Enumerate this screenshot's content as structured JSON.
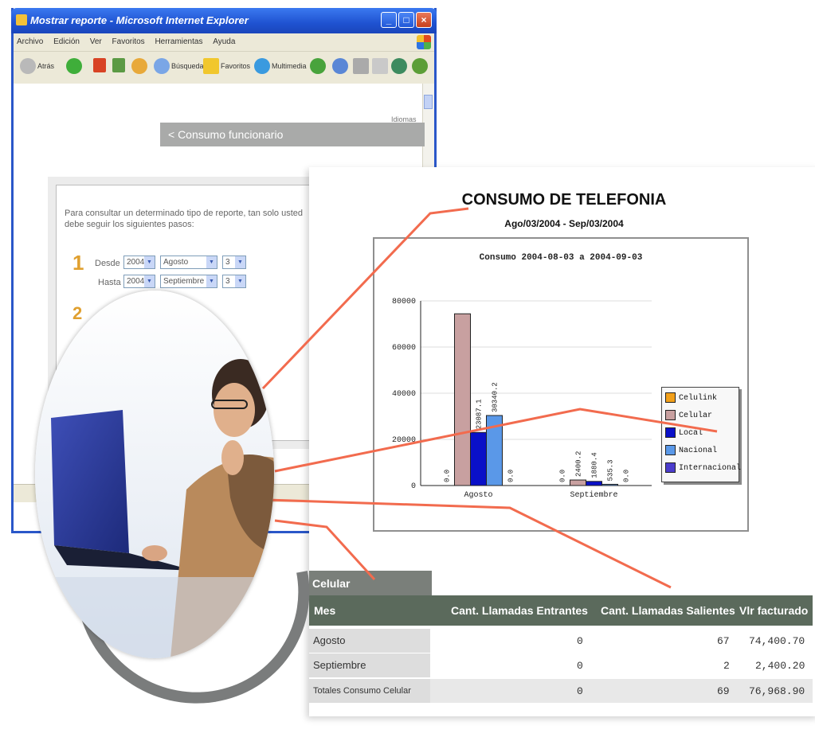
{
  "browser": {
    "title": "Mostrar reporte - Microsoft Internet Explorer",
    "menu": [
      "Archivo",
      "Edición",
      "Ver",
      "Favoritos",
      "Herramientas",
      "Ayuda"
    ],
    "toolbar": {
      "back": "Atrás",
      "search": "Búsqueda",
      "favorites": "Favoritos",
      "multimedia": "Multimedia"
    },
    "idioma": "Idiomas",
    "section_bar": "< Consumo funcionario"
  },
  "form": {
    "instructions": "Para consultar un determinado tipo de reporte, tan solo usted debe seguir los siguientes pasos:",
    "step1": "1",
    "step2": "2",
    "desde_label": "Desde",
    "hasta_label": "Hasta",
    "desde": {
      "year": "2004",
      "month": "Agosto",
      "day": "3"
    },
    "hasta": {
      "year": "2004",
      "month": "Septiembre",
      "day": "3"
    }
  },
  "report": {
    "title": "CONSUMO DE TELEFONIA",
    "subtitle": "Ago/03/2004 - Sep/03/2004"
  },
  "chart_data": {
    "type": "bar",
    "title": "Consumo  2004-08-03 a 2004-09-03",
    "categories": [
      "Agosto",
      "Septiembre"
    ],
    "ylim": [
      0,
      80000
    ],
    "yticks": [
      "0",
      "20000",
      "40000",
      "60000",
      "80000"
    ],
    "series": [
      {
        "name": "Celulink",
        "color": "#f2a01a",
        "values": [
          0,
          0
        ],
        "labels": [
          "0.0",
          "0.0"
        ]
      },
      {
        "name": "Celular",
        "color": "#c8a0a0",
        "values": [
          74400.7,
          2400.2
        ],
        "labels": [
          "",
          "2400.2"
        ]
      },
      {
        "name": "Local",
        "color": "#0a10c8",
        "values": [
          23000,
          1800
        ],
        "labels": [
          "23087.1",
          "1880.4"
        ]
      },
      {
        "name": "Nacional",
        "color": "#5a98e8",
        "values": [
          30340.2,
          535.3
        ],
        "labels": [
          "30340.2",
          "535.3"
        ]
      },
      {
        "name": "Internacional",
        "color": "#4b3ccc",
        "values": [
          0,
          0
        ],
        "labels": [
          "0.0",
          "0.0"
        ]
      }
    ],
    "grid": true,
    "legend": "right"
  },
  "table": {
    "section_label": "Celular",
    "headers": [
      "Mes",
      "Cant. Llamadas Entrantes",
      "Cant. Llamadas Salientes",
      "Vlr facturado"
    ],
    "rows": [
      [
        "Agosto",
        "0",
        "67",
        "74,400.70"
      ],
      [
        "Septiembre",
        "0",
        "2",
        "2,400.20"
      ]
    ],
    "total": [
      "Totales Consumo Celular",
      "0",
      "69",
      "76,968.90"
    ]
  },
  "colors": {
    "callout_line": "#f26b4e",
    "table_header": "#5b6a5c",
    "titlebar": "#2158d8"
  }
}
